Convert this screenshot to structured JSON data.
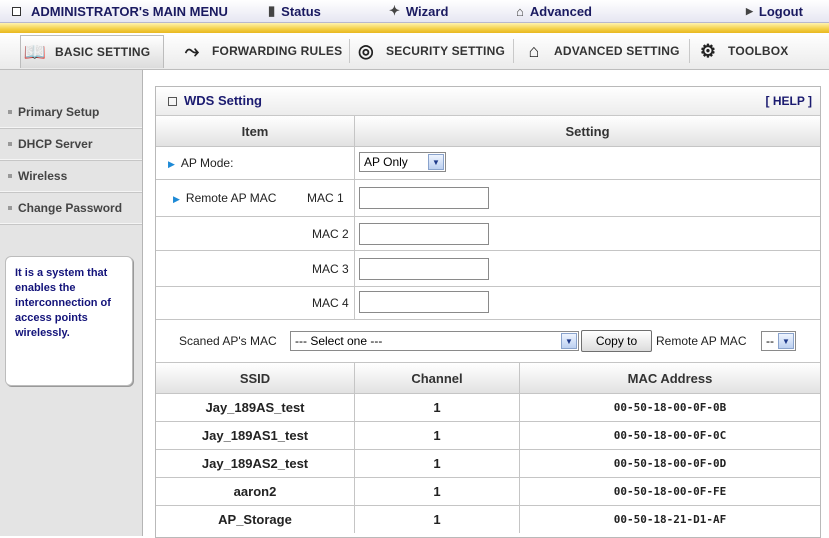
{
  "topmenu": {
    "admin": "ADMINISTRATOR's MAIN MENU",
    "status": "Status",
    "wizard": "Wizard",
    "advanced": "Advanced",
    "logout": "Logout"
  },
  "tabs": [
    {
      "label": "BASIC SETTING"
    },
    {
      "label": "FORWARDING RULES"
    },
    {
      "label": "SECURITY SETTING"
    },
    {
      "label": "ADVANCED SETTING"
    },
    {
      "label": "TOOLBOX"
    }
  ],
  "sidebar": {
    "items": [
      {
        "label": "Primary Setup"
      },
      {
        "label": "DHCP Server"
      },
      {
        "label": "Wireless"
      },
      {
        "label": "Change Password"
      }
    ],
    "help_text": "It is a system that enables the interconnection of access points wirelessly."
  },
  "panel": {
    "title": "WDS Setting",
    "help": "[ HELP ]",
    "col_item": "Item",
    "col_setting": "Setting",
    "ap_mode_label": "AP Mode:",
    "ap_mode_value": "AP Only",
    "remote_label": "Remote AP MAC",
    "mac1": "MAC 1",
    "mac2": "MAC 2",
    "mac3": "MAC 3",
    "mac4": "MAC 4",
    "scanned_label": "Scaned AP's MAC",
    "scanned_value": "--- Select one ---",
    "copy_button": "Copy to",
    "remote_ap_mac_label": "Remote AP MAC",
    "remote_ap_mac_value": "--"
  },
  "scan_table": {
    "headers": [
      "SSID",
      "Channel",
      "MAC Address"
    ],
    "rows": [
      {
        "ssid": "Jay_189AS_test",
        "channel": "1",
        "mac": "00-50-18-00-0F-0B"
      },
      {
        "ssid": "Jay_189AS1_test",
        "channel": "1",
        "mac": "00-50-18-00-0F-0C"
      },
      {
        "ssid": "Jay_189AS2_test",
        "channel": "1",
        "mac": "00-50-18-00-0F-0D"
      },
      {
        "ssid": "aaron2",
        "channel": "1",
        "mac": "00-50-18-00-0F-FE"
      },
      {
        "ssid": "AP_Storage",
        "channel": "1",
        "mac": "00-50-18-21-D1-AF"
      }
    ]
  }
}
